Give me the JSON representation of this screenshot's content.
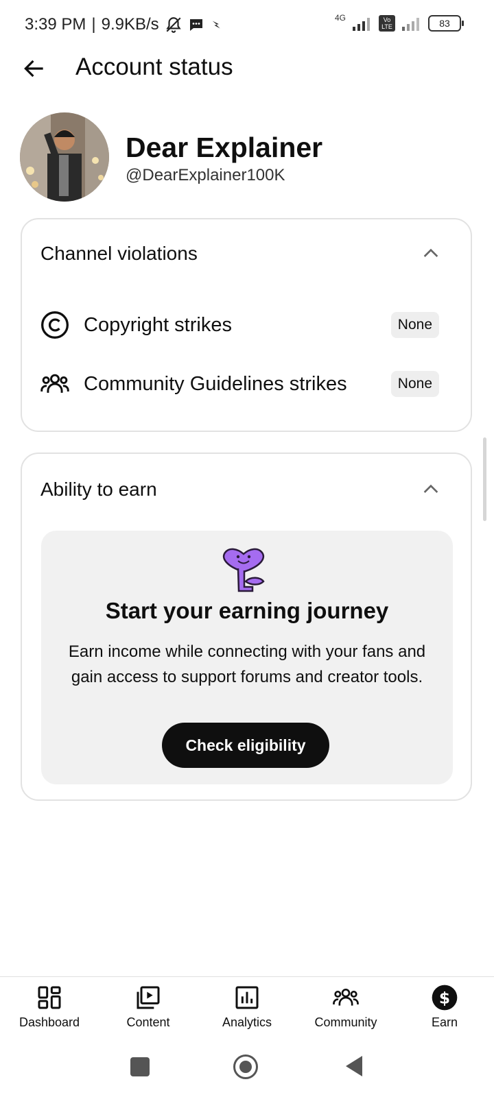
{
  "status_bar": {
    "time": "3:39 PM",
    "speed": "9.9KB/s",
    "network": "4G",
    "volte": "Vo LTE",
    "battery": "83"
  },
  "header": {
    "title": "Account status"
  },
  "channel": {
    "name": "Dear Explainer",
    "handle": "@DearExplainer100K"
  },
  "violations": {
    "title": "Channel violations",
    "items": [
      {
        "label": "Copyright strikes",
        "status": "None",
        "icon": "copyright-icon"
      },
      {
        "label": "Community Guidelines strikes",
        "status": "None",
        "icon": "people-icon"
      }
    ]
  },
  "earn": {
    "title": "Ability to earn",
    "promo_title": "Start your earning journey",
    "promo_desc": "Earn income while connecting with your fans and gain access to support forums and creator tools.",
    "button": "Check eligibility"
  },
  "bottom_nav": [
    {
      "label": "Dashboard",
      "icon": "dashboard-icon"
    },
    {
      "label": "Content",
      "icon": "content-icon"
    },
    {
      "label": "Analytics",
      "icon": "analytics-icon"
    },
    {
      "label": "Community",
      "icon": "community-icon"
    },
    {
      "label": "Earn",
      "icon": "earn-icon"
    }
  ],
  "colors": {
    "accent_purple": "#a56cf0",
    "text": "#0f0f0f",
    "panel": "#f1f1f1"
  }
}
